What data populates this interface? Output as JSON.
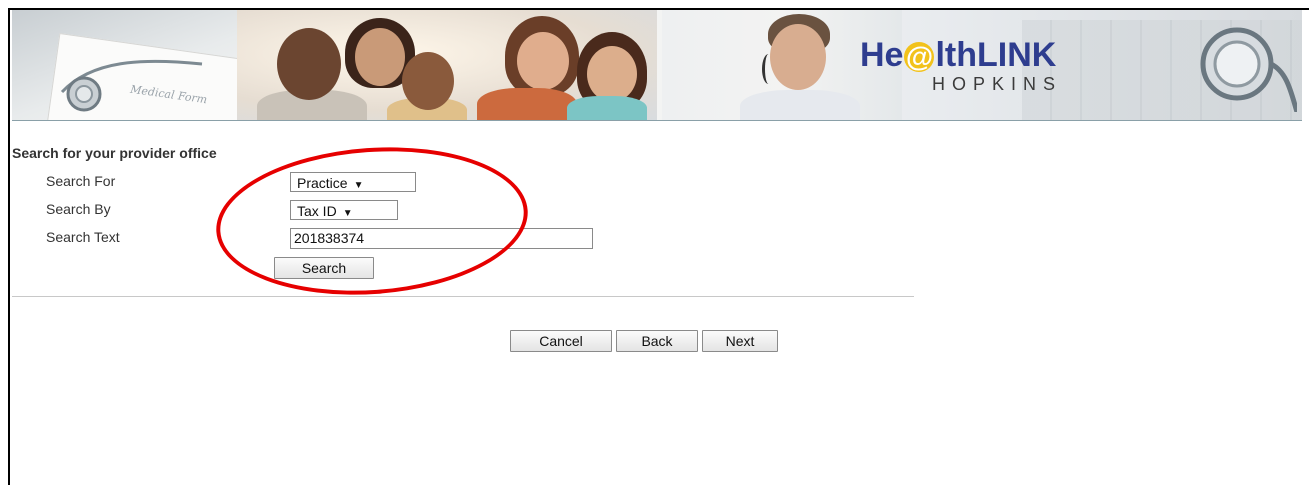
{
  "banner": {
    "paper_text": "Medical Form",
    "logo_prefix": "He",
    "logo_at": "@",
    "logo_suffix": "lthLINK",
    "logo_sub": "HOPKINS",
    "logo_color": "#2e3d8f",
    "logo_accent": "#f2c21b"
  },
  "form": {
    "title": "Search for your provider office",
    "search_for_label": "Search For",
    "search_for_value": "Practice",
    "search_by_label": "Search By",
    "search_by_value": "Tax ID",
    "search_text_label": "Search Text",
    "search_text_value": "201838374",
    "search_button": "Search"
  },
  "actions": {
    "cancel": "Cancel",
    "back": "Back",
    "next": "Next"
  },
  "annotation": {
    "highlight_color": "#e60000"
  }
}
